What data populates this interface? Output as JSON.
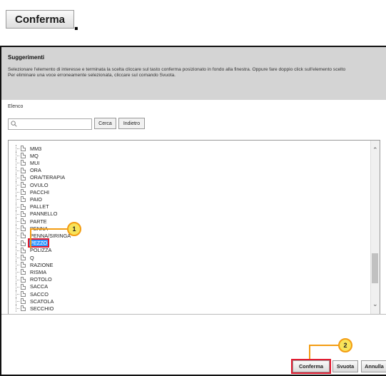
{
  "top_button": {
    "label": "Conferma",
    "suffix": "."
  },
  "suggestions": {
    "title": "Suggerimenti",
    "text_line1": "Selezionare l'elemento di interesse e terminata la scelta cliccare sul tasto conferma posizionato in fondo alla finestra. Oppure fare doppio click sull'elemento scelto",
    "text_line2": "Per eliminare una voce erroneamente selezionata, cliccare sul comando Svuota."
  },
  "list_label": "Elenco",
  "search": {
    "value": "",
    "placeholder": "",
    "cerca_label": "Cerca",
    "indietro_label": "Indietro"
  },
  "tree_items": [
    "MM3",
    "MQ",
    "MUI",
    "ORA",
    "ORA/TERAPIA",
    "OVULO",
    "PACCHI",
    "PAIO",
    "PALLET",
    "PANNELLO",
    "PARTE",
    "PENNA",
    "PENNA/SIRINGA",
    "PEZZO",
    "POLIZZA",
    "Q",
    "RAZIONE",
    "RISMA",
    "ROTOLO",
    "SACCA",
    "SACCO",
    "SCATOLA",
    "SECCHIO"
  ],
  "selected_item": "PEZZO",
  "footer": {
    "confirm_label": "Conferma",
    "clear_label": "Svuota",
    "cancel_label": "Annulla"
  },
  "callouts": [
    "1",
    "2"
  ],
  "colors": {
    "highlight_red": "#e0192f",
    "callout_fill": "#f7e35a",
    "callout_border": "#f39c12",
    "selection_blue": "#3399ff",
    "header_gray": "#d4d4d4"
  }
}
